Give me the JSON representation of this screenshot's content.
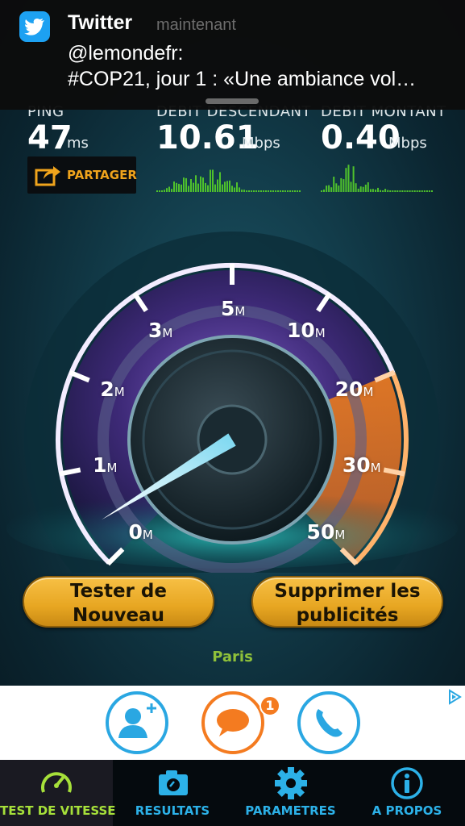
{
  "notification": {
    "app": "Twitter",
    "time": "maintenant",
    "line1": "@lemondefr:",
    "line2": "#COP21, jour 1 : «Une ambiance vol…"
  },
  "stats": {
    "ping": {
      "label": "PING",
      "value": "47",
      "unit": "ms"
    },
    "download": {
      "label": "DEBIT DESCENDANT",
      "value": "10.61",
      "unit": "Mbps"
    },
    "upload": {
      "label": "DEBIT MONTANT",
      "value": "0.40",
      "unit": "Mbps"
    },
    "share_label": "PARTAGER"
  },
  "gauge": {
    "ticks": [
      {
        "value": "0",
        "unit": "M"
      },
      {
        "value": "1",
        "unit": "M"
      },
      {
        "value": "2",
        "unit": "M"
      },
      {
        "value": "3",
        "unit": "M"
      },
      {
        "value": "5",
        "unit": "M"
      },
      {
        "value": "10",
        "unit": "M"
      },
      {
        "value": "20",
        "unit": "M"
      },
      {
        "value": "30",
        "unit": "M"
      },
      {
        "value": "50",
        "unit": "M"
      }
    ],
    "needle_value_mbps": 0.4
  },
  "buttons": {
    "retest_line1": "Tester de",
    "retest_line2": "Nouveau",
    "remove_ads_line1": "Supprimer les",
    "remove_ads_line2": "publicités"
  },
  "server_city": "Paris",
  "ad": {
    "badge_count": "1"
  },
  "tabs": [
    {
      "label": "TEST DE VITESSE",
      "icon": "speedometer-icon"
    },
    {
      "label": "RESULTATS",
      "icon": "camera-icon"
    },
    {
      "label": "PARAMETRES",
      "icon": "gear-icon"
    },
    {
      "label": "A PROPOS",
      "icon": "info-icon"
    }
  ],
  "colors": {
    "accent_orange": "#f0a41c",
    "accent_green": "#a6e03a",
    "accent_blue": "#2cb1e8",
    "button_gold": "#e7a622"
  }
}
